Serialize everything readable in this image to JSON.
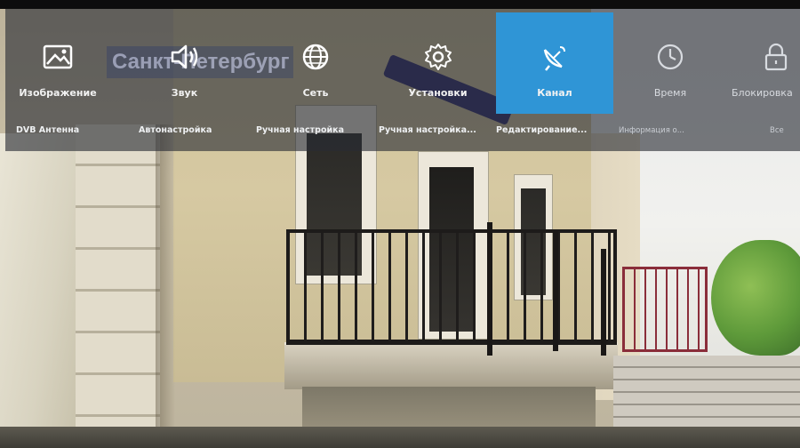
{
  "overlay_caption": "Санкт-Петербург",
  "menu": {
    "items": [
      {
        "label": "Изображение",
        "icon": "picture-icon"
      },
      {
        "label": "Звук",
        "icon": "speaker-icon"
      },
      {
        "label": "Сеть",
        "icon": "globe-icon"
      },
      {
        "label": "Установки",
        "icon": "gear-icon"
      },
      {
        "label": "Канал",
        "icon": "satellite-dish-icon",
        "active": true
      },
      {
        "label": "Время",
        "icon": "clock-icon"
      },
      {
        "label": "Блокировка",
        "icon": "lock-icon"
      }
    ],
    "active_color": "#2f95d6"
  },
  "submenu": {
    "items": [
      "DVB Антенна",
      "Автонастройка",
      "Ручная настройка",
      "Ручная настройка...",
      "Редактирование...",
      "Информация о...",
      "Все"
    ]
  }
}
